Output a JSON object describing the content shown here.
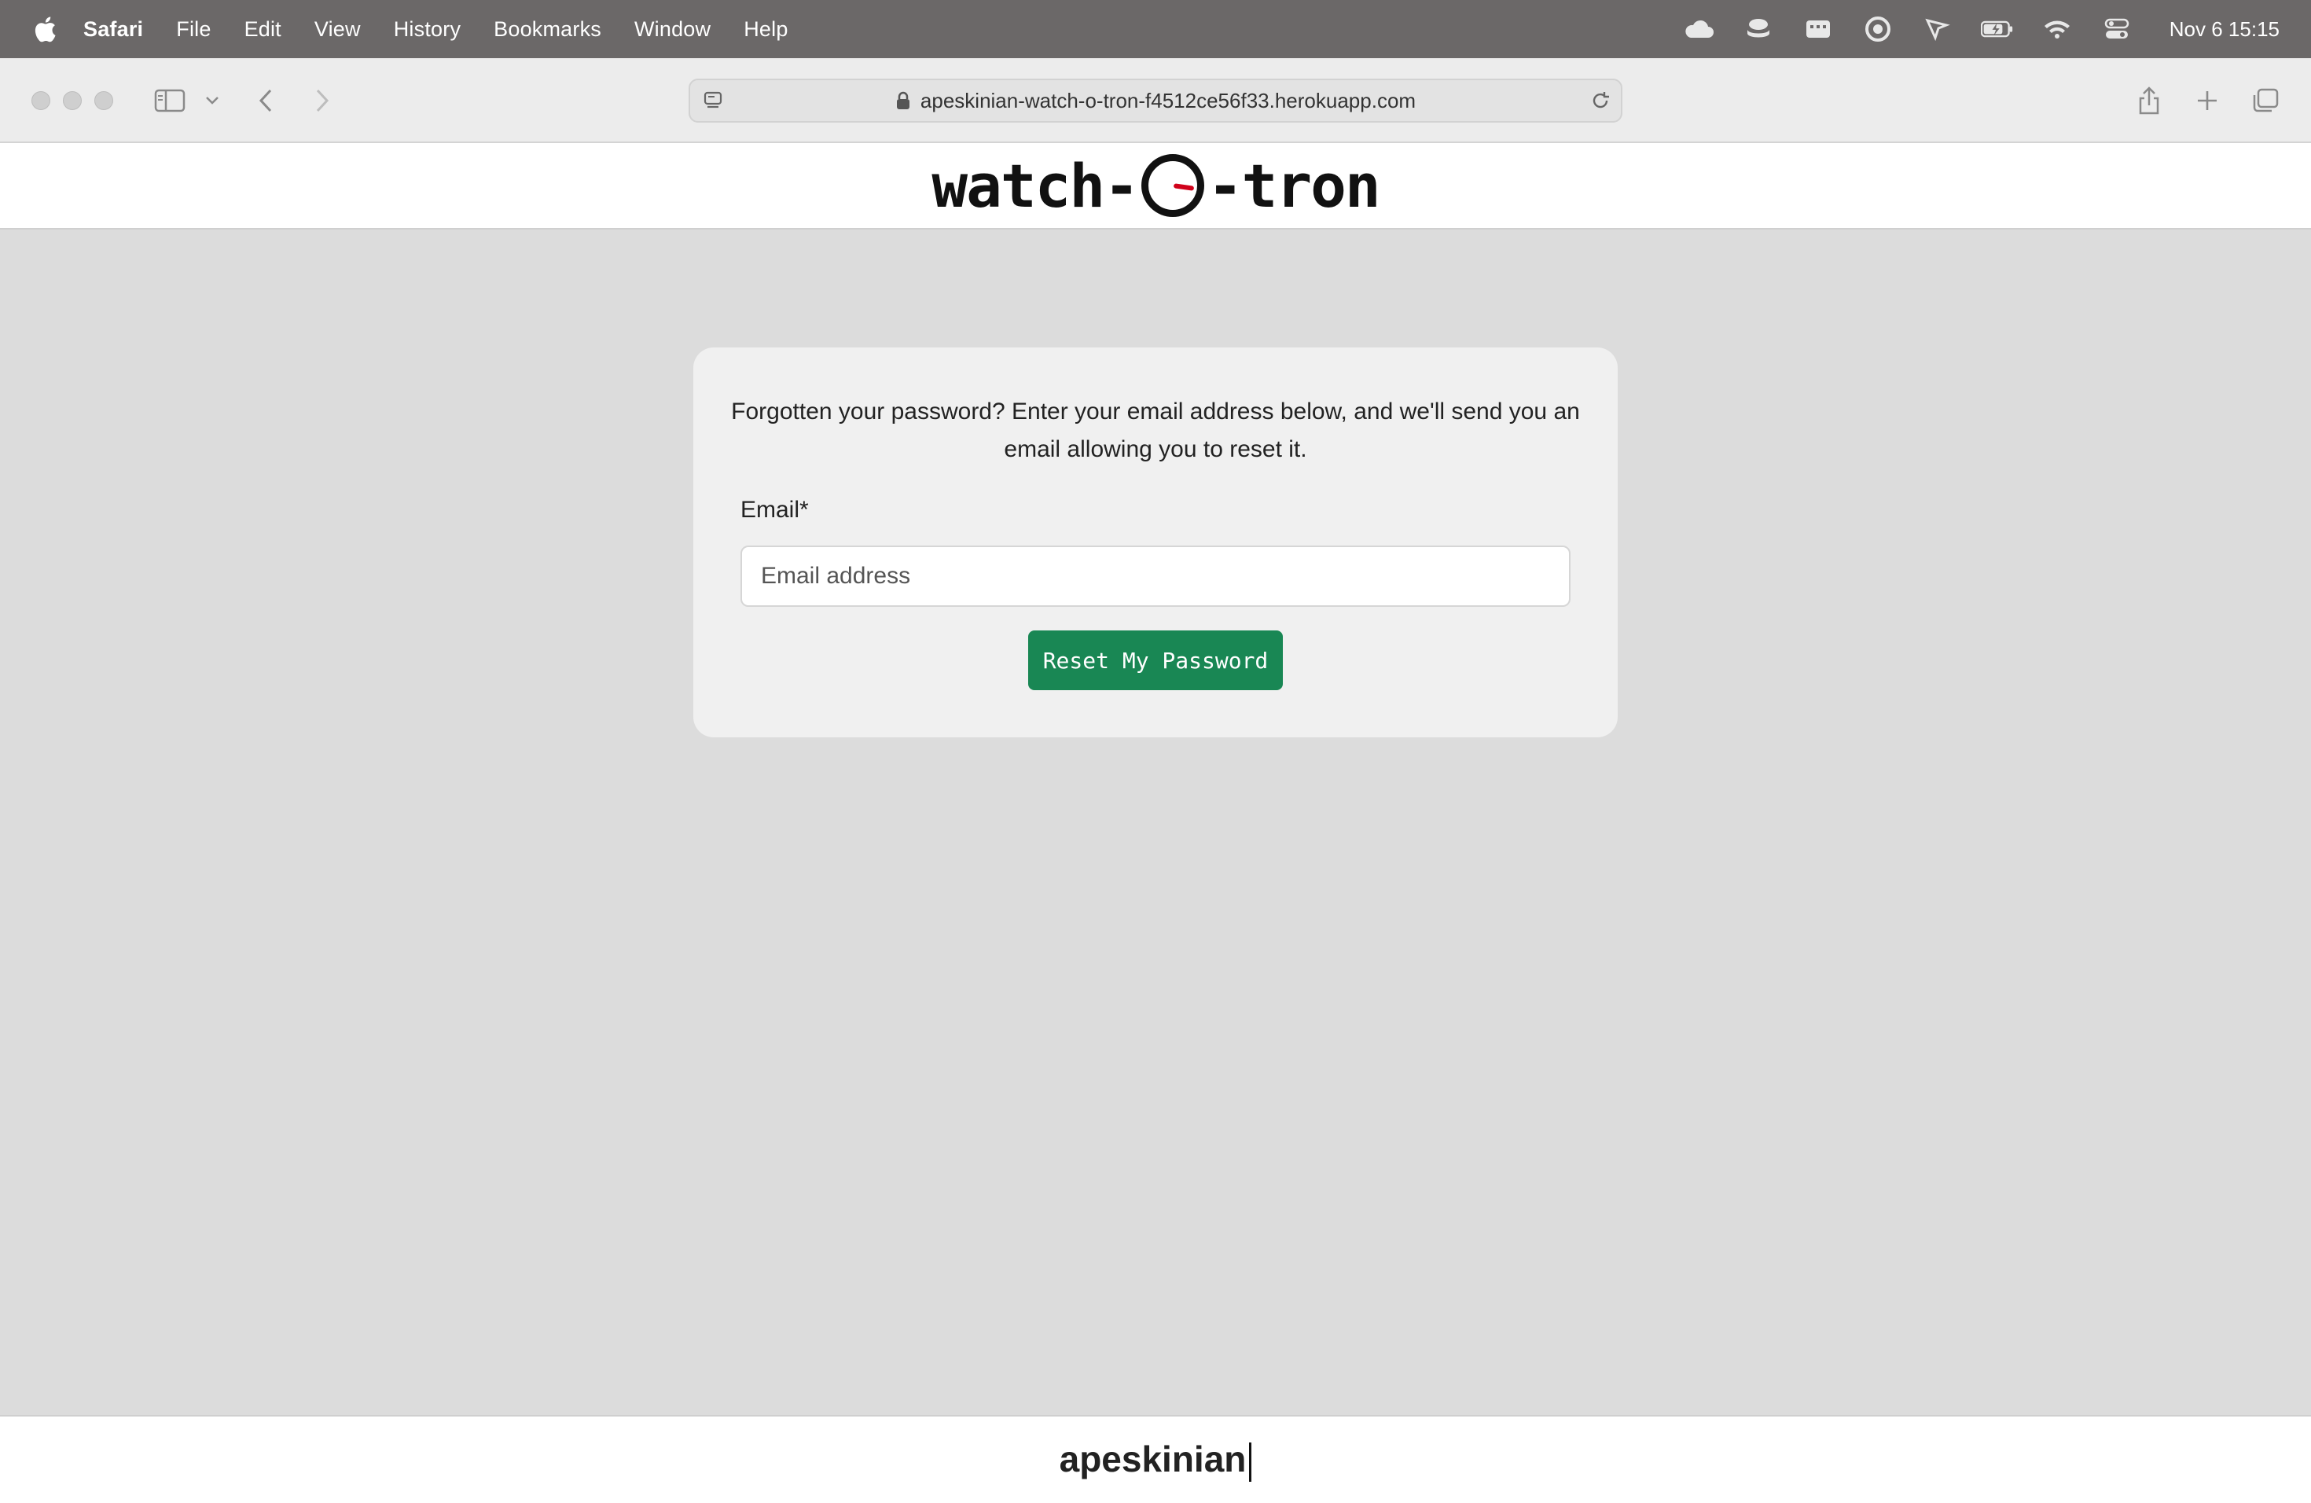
{
  "menubar": {
    "app": "Safari",
    "items": [
      "File",
      "Edit",
      "View",
      "History",
      "Bookmarks",
      "Window",
      "Help"
    ],
    "clock": "Nov 6  15:15"
  },
  "browser": {
    "url": "apeskinian-watch-o-tron-f4512ce56f33.herokuapp.com"
  },
  "site": {
    "logo_left": "watch-",
    "logo_right": "-tron"
  },
  "reset_form": {
    "intro": "Forgotten your password? Enter your email address below, and we'll send you an email allowing you to reset it.",
    "email_label": "Email*",
    "email_value": "",
    "email_placeholder": "Email address",
    "submit_label": "Reset My Password"
  },
  "footer": {
    "username": "apeskinian"
  },
  "colors": {
    "primary_button": "#198754",
    "logo_hand": "#d0021b"
  }
}
